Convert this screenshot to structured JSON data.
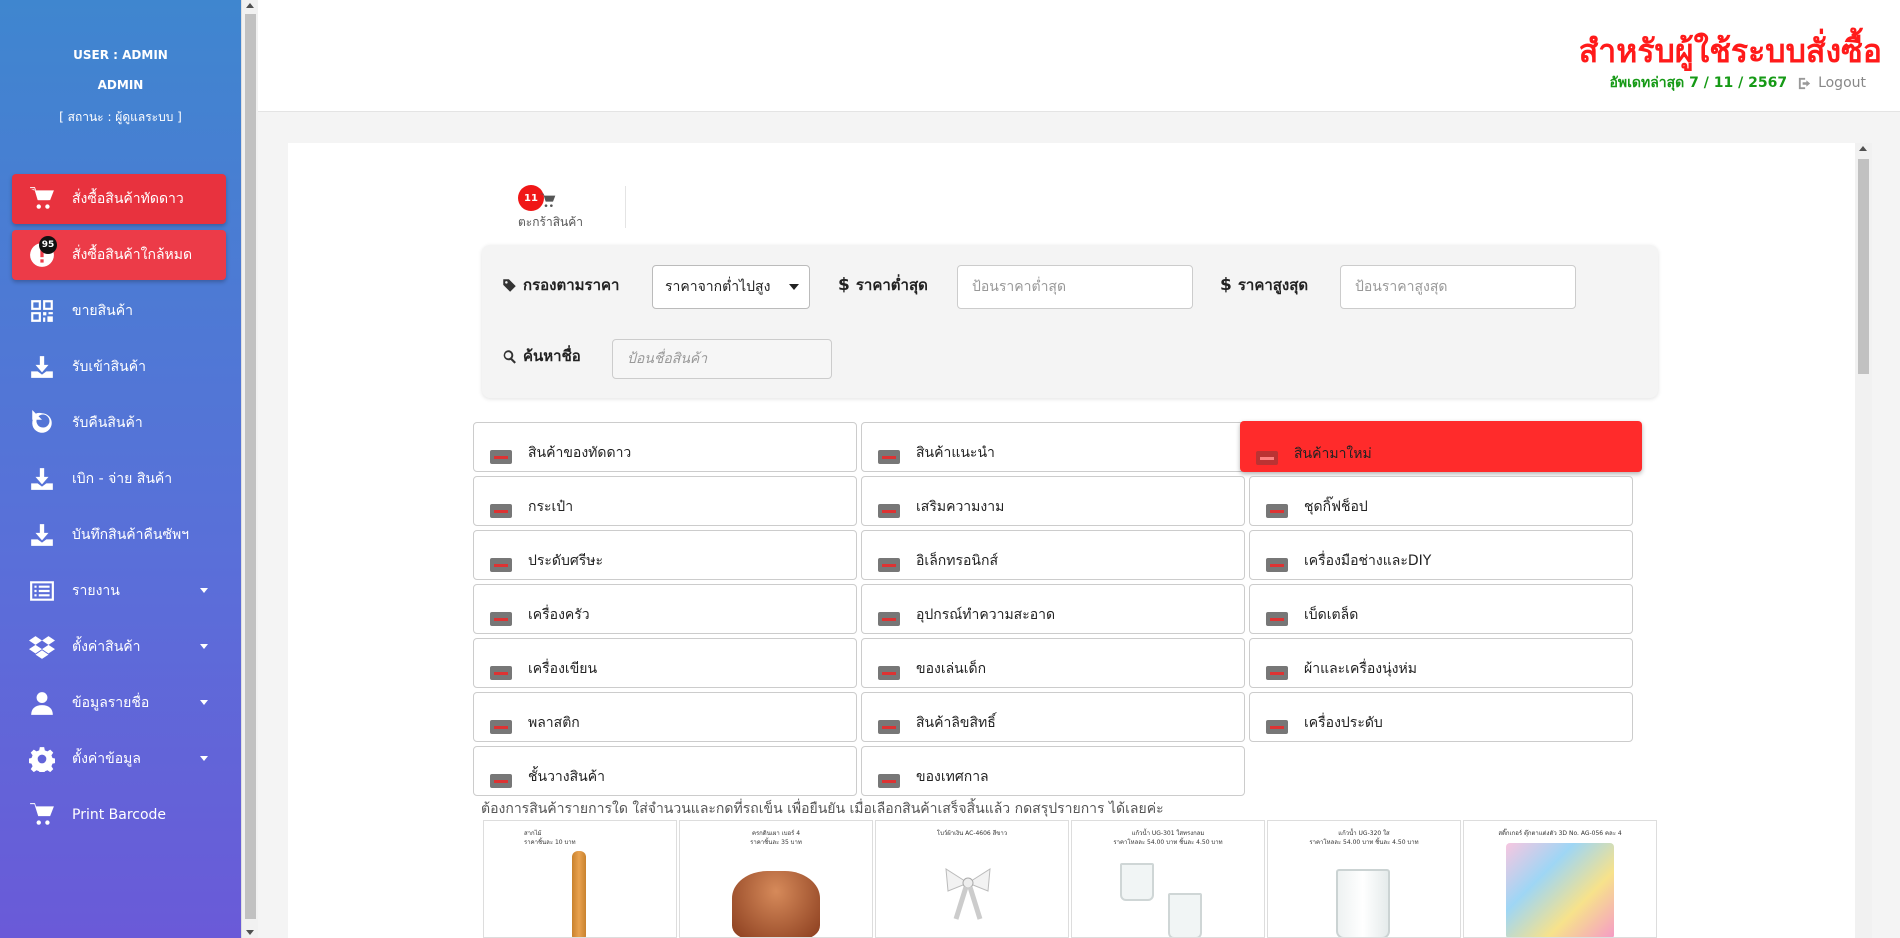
{
  "user": {
    "user_line": "USER : ADMIN",
    "name": "ADMIN",
    "status": "[ สถานะ : ผู้ดูแลระบบ ]"
  },
  "sidebar": {
    "items": [
      {
        "label": "สั่งซื้อสินค้าทัดดาว",
        "icon": "cart-icon"
      },
      {
        "label": "สั่งซื้อสินค้าใกล้หมด",
        "icon": "alert-icon",
        "badge": "95"
      },
      {
        "label": "ขายสินค้า",
        "icon": "qrcode-icon"
      },
      {
        "label": "รับเข้าสินค้า",
        "icon": "download-icon"
      },
      {
        "label": "รับคืนสินค้า",
        "icon": "undo-icon"
      },
      {
        "label": "เบิก - จ่าย สินค้า",
        "icon": "download-icon"
      },
      {
        "label": "บันทึกสินค้าคืนซัพฯ",
        "icon": "download-icon"
      },
      {
        "label": "รายงาน",
        "icon": "list-icon"
      },
      {
        "label": "ตั้งค่าสินค้า",
        "icon": "dropbox-icon"
      },
      {
        "label": "ข้อมูลรายชื่อ",
        "icon": "user-icon"
      },
      {
        "label": "ตั้งค่าข้อมูล",
        "icon": "gear-icon"
      },
      {
        "label": "Print Barcode",
        "icon": "cart-icon"
      }
    ]
  },
  "header": {
    "title": "สำหรับผู้ใช้ระบบสั่งซื้อ",
    "updated": "อัพเดทล่าสุด 7 / 11 / 2567",
    "logout": "Logout"
  },
  "cart": {
    "count": "11",
    "label": "ตะกร้าสินค้า"
  },
  "filter": {
    "price_filter_label": "กรองตามราคา",
    "sort_selected": "ราคาจากต่ำไปสูง",
    "min_label": "ราคาต่ำสุด",
    "min_placeholder": "ป้อนราคาต่ำสุด",
    "max_label": "ราคาสูงสุด",
    "max_placeholder": "ป้อนราคาสูงสุด",
    "search_label": "ค้นหาชื่อ",
    "search_placeholder": "ป้อนชื่อสินค้า"
  },
  "categories": [
    "สินค้าของทัดดาว",
    "สินค้าแนะนำ",
    "สินค้ามาใหม่",
    "กระเป๋า",
    "เสริมความงาม",
    "ชุดกิ๊ฟช็อป",
    "ประดับศรีษะ",
    "อิเล็กทรอนิกส์",
    "เครื่องมือช่างและDIY",
    "เครื่องครัว",
    "อุปกรณ์ทำความสะอาด",
    "เบ็ดเตล็ด",
    "เครื่องเขียน",
    "ของเล่นเด็ก",
    "ผ้าและเครื่องนุ่งห่ม",
    "พลาสติก",
    "สินค้าลิขสิทธิ์",
    "เครื่องประดับ",
    "ชั้นวางสินค้า",
    "ของเทศกาล"
  ],
  "highlight_category_index": 2,
  "instruction": "ต้องการสินค้ารายการใด ใส่จำนวนและกดที่รถเข็น เพื่อยืนยัน เมื่อเลือกสินค้าเสร็จสิ้นแล้ว กดสรุปรายการ ได้เลยค่ะ",
  "products": [
    {
      "caption": "สากไม้\nราคาชิ้นละ 10 บาท"
    },
    {
      "caption": "ครกดินเผา เบอร์ 4\nราคาชิ้นละ 35 บาท"
    },
    {
      "caption": "โบว์ผ้าเงิน AC-4606 สีขาว"
    },
    {
      "caption": "แก้วน้ำ UG-301 ใสทรงกลม\nราคาโหลละ 54.00 บาท ชิ้นละ 4.50 บาท"
    },
    {
      "caption": "แก้วน้ำ UG-320 ใส\nราคาโหลละ 54.00 บาท ชิ้นละ 4.50 บาท"
    },
    {
      "caption": "สติ๊กเกอร์ ตุ๊กตาแต่งตัว 3D No. AG-056 คละ 4"
    }
  ],
  "colors": {
    "accent_red": "#ff2b2b",
    "title_red": "#ff1a1a",
    "update_green": "#169a16",
    "sidebar_top": "#3f86cf",
    "sidebar_bottom": "#6a5ad8"
  }
}
